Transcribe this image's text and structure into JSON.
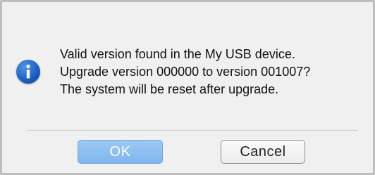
{
  "dialog": {
    "icon": "info-icon",
    "message_lines": [
      "Valid version found in the My USB device.",
      "Upgrade version 000000 to version 001007?",
      "The system will be reset after upgrade."
    ],
    "buttons": {
      "ok_label": "OK",
      "cancel_label": "Cancel"
    }
  },
  "colors": {
    "ok_button": "#8dbff1",
    "icon": "#1d62c4",
    "dialog_background": "#f0f0f0"
  }
}
